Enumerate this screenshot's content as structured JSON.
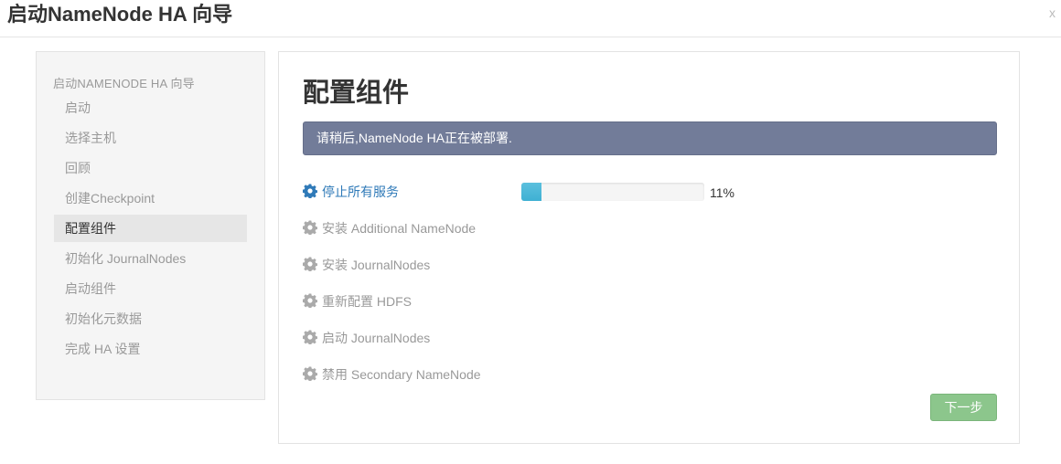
{
  "window": {
    "title": "启动NameNode HA 向导",
    "close_label": "x"
  },
  "sidebar": {
    "header": "启动NAMENODE HA 向导",
    "items": [
      {
        "label": "启动",
        "active": false
      },
      {
        "label": "选择主机",
        "active": false
      },
      {
        "label": "回顾",
        "active": false
      },
      {
        "label": "创建Checkpoint",
        "active": false
      },
      {
        "label": "配置组件",
        "active": true
      },
      {
        "label": "初始化 JournalNodes",
        "active": false
      },
      {
        "label": "启动组件",
        "active": false
      },
      {
        "label": "初始化元数据",
        "active": false
      },
      {
        "label": "完成 HA 设置",
        "active": false
      }
    ]
  },
  "main": {
    "title": "配置组件",
    "alert": "请稍后,NameNode HA正在被部署.",
    "tasks": [
      {
        "label": "停止所有服务",
        "icon": "gear-icon",
        "active": true
      },
      {
        "label": "安装 Additional NameNode",
        "icon": "gear-icon",
        "active": false
      },
      {
        "label": "安装 JournalNodes",
        "icon": "gear-icon",
        "active": false
      },
      {
        "label": "重新配置 HDFS",
        "icon": "gear-icon",
        "active": false
      },
      {
        "label": "启动 JournalNodes",
        "icon": "gear-icon",
        "active": false
      },
      {
        "label": "禁用 Secondary NameNode",
        "icon": "gear-icon",
        "active": false
      }
    ],
    "progress": {
      "percent": 11,
      "text": "11%"
    },
    "next_button": "下一步"
  },
  "colors": {
    "alert_bg": "#727c99",
    "active_task": "#2f7ab8",
    "inactive_gear": "#aaaaaa",
    "progress_fill": "#5bc0de",
    "next_button_bg": "#8cc68c"
  }
}
